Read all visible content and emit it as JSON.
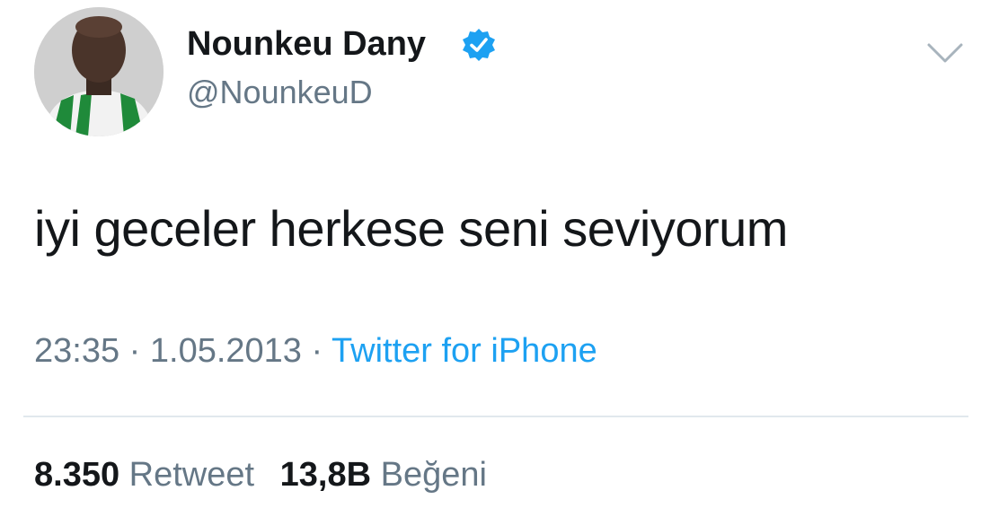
{
  "tweet": {
    "author": {
      "display_name": "Nounkeu Dany",
      "handle": "@NounkeuD",
      "verified": true,
      "avatar_icon": "profile-photo"
    },
    "text": "iyi geceler herkese seni seviyorum",
    "time": "23:35",
    "date": "1.05.2013",
    "separator": "·",
    "source": "Twitter for iPhone",
    "stats": {
      "retweet_count": "8.350",
      "retweet_label": "Retweet",
      "like_count": "13,8B",
      "like_label": "Beğeni"
    }
  },
  "colors": {
    "text_primary": "#14171a",
    "text_secondary": "#657786",
    "link_blue": "#1da1f2",
    "divider": "#e1e8ed",
    "verified_blue": "#1da1f2"
  }
}
